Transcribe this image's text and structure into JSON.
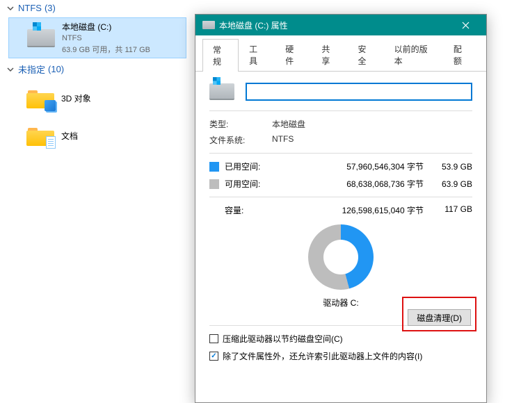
{
  "explorer": {
    "groups": [
      {
        "name": "NTFS",
        "count": "(3)"
      },
      {
        "name": "未指定",
        "count": "(10)"
      }
    ],
    "drive": {
      "name": "本地磁盘 (C:)",
      "fs": "NTFS",
      "space": "63.9 GB 可用，共 117 GB"
    },
    "items": [
      {
        "name": "3D 对象"
      },
      {
        "name": "文档"
      }
    ]
  },
  "dialog": {
    "title": "本地磁盘 (C:) 属性",
    "tabs": [
      "常规",
      "工具",
      "硬件",
      "共享",
      "安全",
      "以前的版本",
      "配额"
    ],
    "name_value": "",
    "type_label": "类型:",
    "type_value": "本地磁盘",
    "fs_label": "文件系统:",
    "fs_value": "NTFS",
    "used_label": "已用空间:",
    "used_bytes": "57,960,546,304 字节",
    "used_gb": "53.9 GB",
    "free_label": "可用空间:",
    "free_bytes": "68,638,068,736 字节",
    "free_gb": "63.9 GB",
    "cap_label": "容量:",
    "cap_bytes": "126,598,615,040 字节",
    "cap_gb": "117 GB",
    "drive_caption": "驱动器 C:",
    "cleanup_btn": "磁盘清理(D)",
    "compress_label": "压缩此驱动器以节约磁盘空间(C)",
    "index_label": "除了文件属性外，还允许索引此驱动器上文件的内容(I)"
  },
  "chart_data": {
    "type": "pie",
    "title": "驱动器 C:",
    "series": [
      {
        "name": "已用空间",
        "value": 57960546304,
        "label": "53.9 GB",
        "color": "#2196f3"
      },
      {
        "name": "可用空间",
        "value": 68638068736,
        "label": "63.9 GB",
        "color": "#bdbdbd"
      }
    ],
    "total": 126598615040,
    "used_fraction": 0.458
  }
}
